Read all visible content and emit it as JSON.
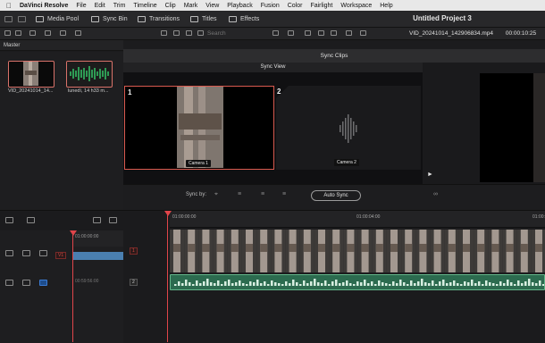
{
  "menubar": {
    "app": "DaVinci Resolve",
    "items": [
      "File",
      "Edit",
      "Trim",
      "Timeline",
      "Clip",
      "Mark",
      "View",
      "Playback",
      "Fusion",
      "Color",
      "Fairlight",
      "Workspace",
      "Help"
    ]
  },
  "toolbar": {
    "media_pool": "Media Pool",
    "sync_bin": "Sync Bin",
    "transitions": "Transitions",
    "titles": "Titles",
    "effects": "Effects",
    "project_title": "Untitled Project 3"
  },
  "subbar": {
    "search_placeholder": "Search",
    "clip_name": "VID_20241014_142906834.mp4",
    "timecode": "00:00:10:25"
  },
  "media_pool": {
    "bin_name": "Master",
    "clips": [
      {
        "label": "VID_20241014_14...",
        "kind": "video"
      },
      {
        "label": "lunedì, 14 h33 m...",
        "kind": "audio"
      }
    ]
  },
  "sync": {
    "header": "Sync Clips",
    "view_title": "Sync View",
    "angles": [
      {
        "number": "1",
        "name": "Camera 1"
      },
      {
        "number": "2",
        "name": "Camera 2"
      }
    ],
    "sync_by_label": "Sync by:",
    "auto_sync_label": "Auto Sync"
  },
  "timeline": {
    "ruler_labels": [
      "01:00:00:00",
      "01:00:04:00",
      "01:00:"
    ],
    "mini_ruler_label": "01:00:00:00",
    "mini_audio_label": "00:59:56:00",
    "video_track_tag": "1",
    "audio_track_tag": "2",
    "mini_v_tag": "V1"
  },
  "colors": {
    "accent_red": "#d95a4f",
    "audio_green": "#2c6b4f",
    "mini_clip_blue": "#4a7fb0"
  }
}
